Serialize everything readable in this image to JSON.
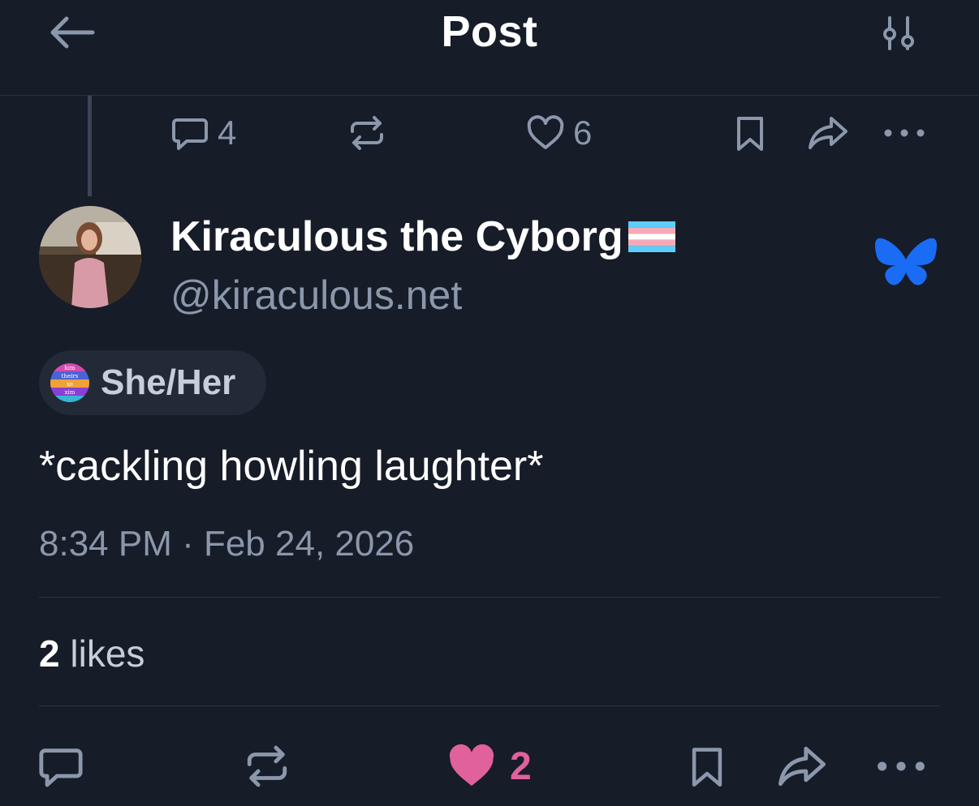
{
  "header": {
    "title": "Post",
    "back_icon": "back-arrow-icon",
    "settings_icon": "thread-settings-icon"
  },
  "parent_actions": {
    "reply_count": "4",
    "like_count": "6"
  },
  "author": {
    "display_name": "Kiraculous the Cyborg",
    "flag_icon": "transgender-flag-icon",
    "handle": "@kiraculous.net",
    "verified_icon": "bluesky-butterfly-icon"
  },
  "pronouns": {
    "label": "She/Her",
    "badge_words": [
      "him",
      "theirs",
      "xe",
      "xim"
    ]
  },
  "post": {
    "text": "*cackling howling laughter*",
    "timestamp": "8:34 PM · Feb 24, 2026"
  },
  "likes": {
    "count": "2",
    "label": "likes"
  },
  "actions": {
    "like_count": "2"
  },
  "colors": {
    "background": "#161c28",
    "muted": "#8b97ab",
    "like_pink": "#e0619c",
    "bluesky_blue": "#1a6cf5"
  }
}
